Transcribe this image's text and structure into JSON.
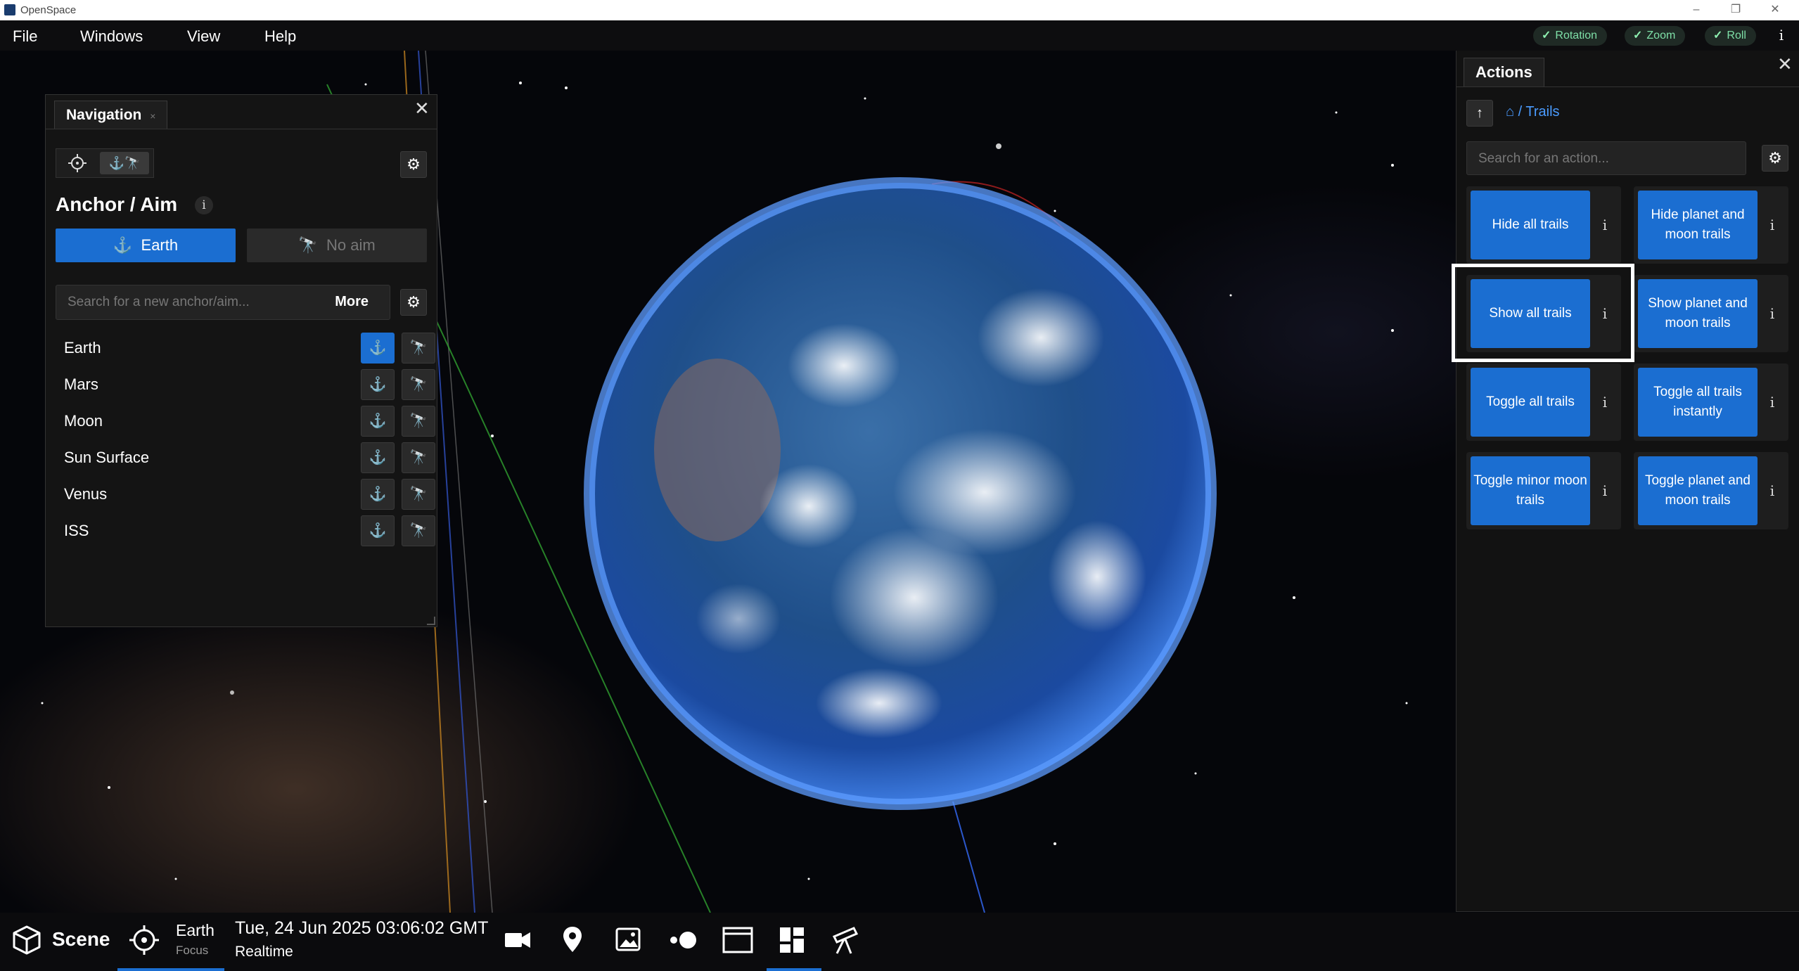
{
  "window": {
    "title": "OpenSpace",
    "controls": [
      "–",
      "❐",
      "✕"
    ]
  },
  "menu": [
    "File",
    "Windows",
    "View",
    "Help"
  ],
  "camera_toggles": [
    {
      "label": "Rotation"
    },
    {
      "label": "Zoom"
    },
    {
      "label": "Roll"
    }
  ],
  "info_glyph": "i",
  "navigation": {
    "tab_label": "Navigation",
    "tab_close": "×",
    "close": "✕",
    "mode_icons": "⚓🔭",
    "heading": "Anchor / Aim",
    "anchor_value": "Earth",
    "aim_value": "No aim",
    "search_placeholder": "Search for a new anchor/aim...",
    "more_label": "More",
    "objects": [
      {
        "name": "Earth",
        "anchored": true
      },
      {
        "name": "Mars",
        "anchored": false
      },
      {
        "name": "Moon",
        "anchored": false
      },
      {
        "name": "Sun Surface",
        "anchored": false
      },
      {
        "name": "Venus",
        "anchored": false
      },
      {
        "name": "ISS",
        "anchored": false
      }
    ]
  },
  "actions_panel": {
    "tab_label": "Actions",
    "close": "✕",
    "breadcrumb": "/ Trails",
    "search_placeholder": "Search for an action...",
    "actions": [
      "Hide all trails",
      "Hide planet and moon trails",
      "Show all trails",
      "Show planet and moon trails",
      "Toggle all trails",
      "Toggle all trails instantly",
      "Toggle minor moon trails",
      "Toggle planet and moon trails"
    ],
    "highlighted_action": "Show all trails"
  },
  "bottom_bar": {
    "scene_label": "Scene",
    "focus_name": "Earth",
    "focus_sublabel": "Focus",
    "datetime": "Tue, 24 Jun 2025 03:06:02 GMT",
    "time_mode": "Realtime"
  },
  "colors": {
    "accent": "#1b6ed1",
    "toggle_text": "#7fe0a8",
    "link": "#4a9bff"
  }
}
